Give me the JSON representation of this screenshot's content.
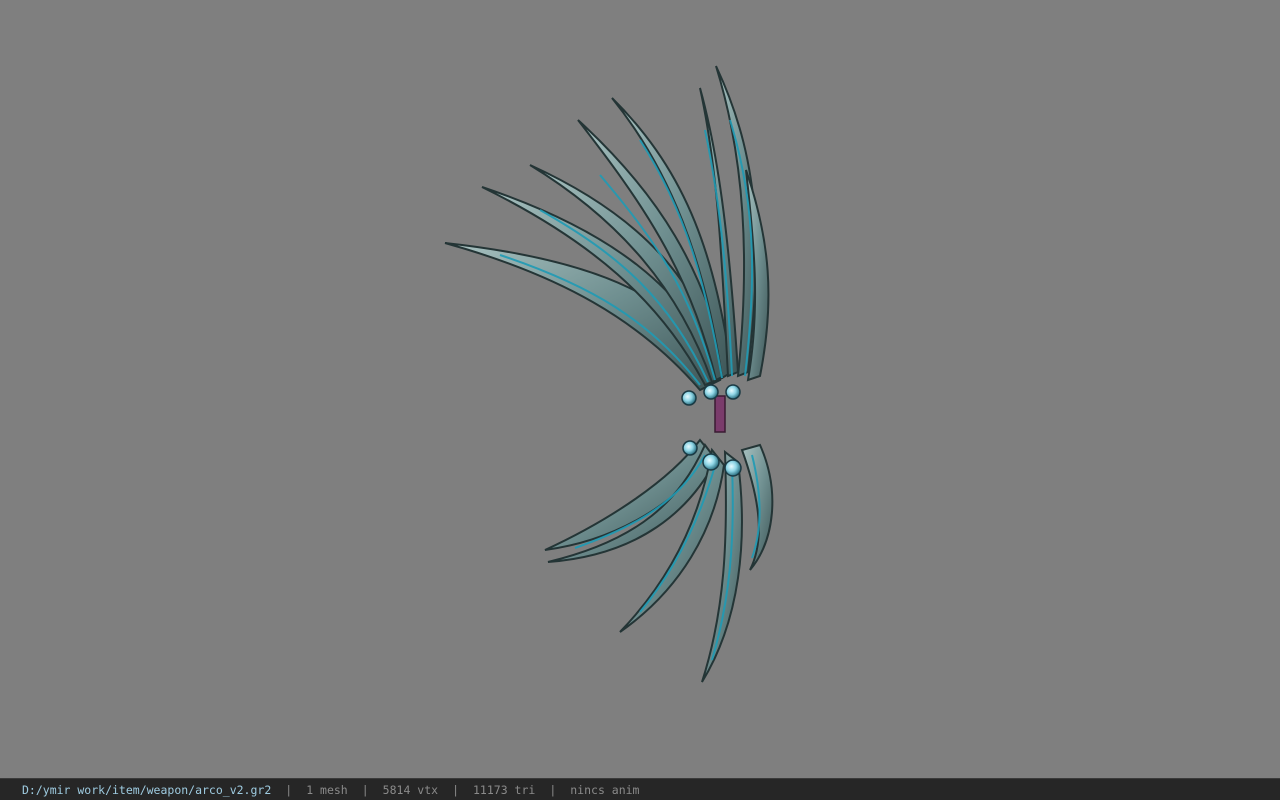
{
  "viewer": {
    "background_color": "#7f7f7f",
    "model_description_icon": "weapon-model-icon",
    "model_colors": {
      "blade": "#7f9ea0",
      "blade_dark": "#2f4446",
      "edge_glow": "#2aa0b8",
      "orb": "#9fe6f2",
      "handle": "#7a3b6b"
    }
  },
  "status": {
    "file_path": "D:/ymir work/item/weapon/arco_v2.gr2",
    "mesh_count": "1 mesh",
    "vertex_count": "5814 vtx",
    "triangle_count": "11173 tri",
    "anim_status": "nincs anim",
    "separator": "|"
  }
}
